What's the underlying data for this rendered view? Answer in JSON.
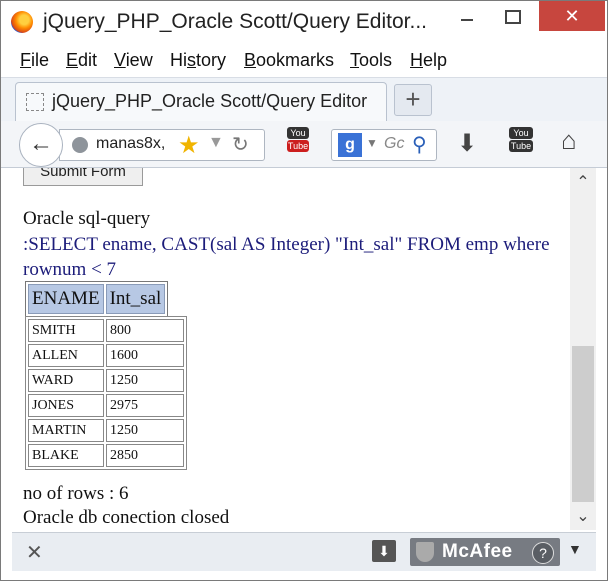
{
  "window": {
    "title": "jQuery_PHP_Oracle Scott/Query Editor...",
    "controls": {
      "minimize": "",
      "maximize": "",
      "close": "✕"
    }
  },
  "menu": {
    "file": {
      "key": "F",
      "rest": "ile"
    },
    "edit": {
      "key": "E",
      "rest": "dit"
    },
    "view": {
      "key": "V",
      "rest": "iew"
    },
    "history": {
      "pre": "Hi",
      "key": "s",
      "rest": "tory"
    },
    "bookmarks": {
      "key": "B",
      "rest": "ookmarks"
    },
    "tools": {
      "key": "T",
      "rest": "ools"
    },
    "help": {
      "key": "H",
      "rest": "elp"
    }
  },
  "tab": {
    "label": "jQuery_PHP_Oracle Scott/Query Editor",
    "new_tab": "+"
  },
  "nav": {
    "back": "←",
    "url": "manas8x,",
    "search_placeholder": "Gc",
    "search_engine": "g",
    "yt_top": "You",
    "yt_bottom": "Tube"
  },
  "page": {
    "submit_label": "Submit Form",
    "heading": "Oracle sql-query",
    "query": ":SELECT ename, CAST(sal AS Integer) \"Int_sal\" FROM emp where rownum < 7",
    "columns": [
      "ENAME",
      "Int_sal"
    ],
    "rows": [
      [
        "SMITH",
        "800"
      ],
      [
        "ALLEN",
        "1600"
      ],
      [
        "WARD",
        "1250"
      ],
      [
        "JONES",
        "2975"
      ],
      [
        "MARTIN",
        "1250"
      ],
      [
        "BLAKE",
        "2850"
      ]
    ],
    "row_count_text": "no of rows : 6",
    "closed_text": "Oracle db conection closed"
  },
  "bottom": {
    "close": "✕",
    "mcafee_label": "McAfee",
    "help": "?"
  },
  "icons": {
    "back": "arrow-left-icon",
    "star": "star-icon",
    "reload": "reload-icon",
    "download": "download-icon",
    "home": "home-icon"
  }
}
